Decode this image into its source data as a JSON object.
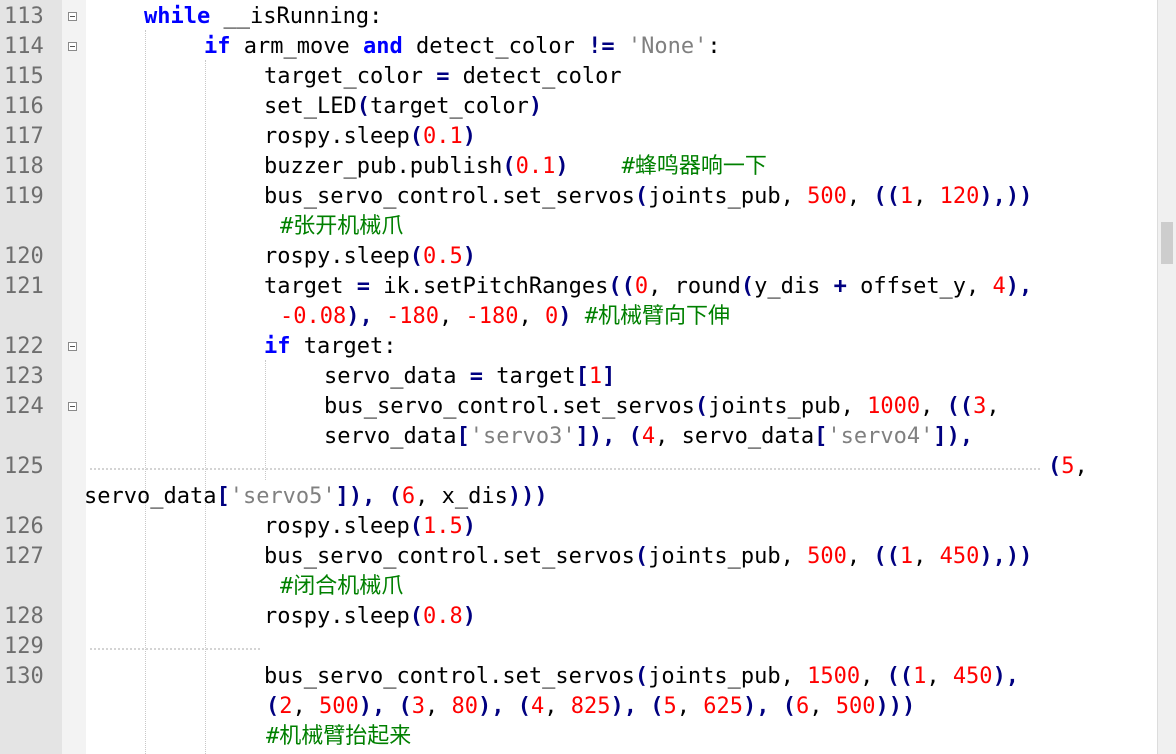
{
  "editor": {
    "lines": {
      "113": {
        "num": "113",
        "kw1": "while",
        "rest": " __isRunning:"
      },
      "114": {
        "num": "114",
        "kw1": "if",
        "a": " arm_move ",
        "kw2": "and",
        "b": " detect_color ",
        "op": "!=",
        "c": " ",
        "str": "'None'",
        "d": ":"
      },
      "115": {
        "num": "115",
        "a": "target_color ",
        "op": "=",
        "b": " detect_color"
      },
      "116": {
        "num": "116",
        "a": "set_LED",
        "p1": "(",
        "b": "target_color",
        "p2": ")"
      },
      "117": {
        "num": "117",
        "a": "rospy.sleep",
        "p1": "(",
        "n1": "0.1",
        "p2": ")"
      },
      "118": {
        "num": "118",
        "a": "buzzer_pub.publish",
        "p1": "(",
        "n1": "0.1",
        "p2": ")",
        "cmt": "#蜂鸣器响一下"
      },
      "119": {
        "num": "119",
        "a": "bus_servo_control.set_servos",
        "p1": "(",
        "b": "joints_pub, ",
        "n1": "500",
        "c": ", ",
        "p2": "((",
        "n2": "1",
        "d": ", ",
        "n3": "120",
        "p3": "),))",
        "cmt": "#张开机械爪"
      },
      "120": {
        "num": "120",
        "a": "rospy.sleep",
        "p1": "(",
        "n1": "0.5",
        "p2": ")"
      },
      "121": {
        "num": "121",
        "a": "target ",
        "op": "=",
        "b": " ik.setPitchRanges",
        "p1": "((",
        "n1": "0",
        "c": ", round",
        "p2": "(",
        "d": "y_dis ",
        "op2": "+",
        "e": " offset_y, ",
        "n2": "4",
        "p3": "),",
        "n3": "-0.08",
        "p4": "),",
        "n4": "-180",
        "f": ", ",
        "n5": "-180",
        "g": ", ",
        "n6": "0",
        "p5": ")",
        "cmt": "#机械臂向下伸"
      },
      "122": {
        "num": "122",
        "kw1": "if",
        "rest": " target:"
      },
      "123": {
        "num": "123",
        "a": "servo_data ",
        "op": "=",
        "b": " target",
        "p1": "[",
        "n1": "1",
        "p2": "]"
      },
      "124": {
        "num": "124",
        "a": "bus_servo_control.set_servos",
        "p1": "(",
        "b": "joints_pub, ",
        "n1": "1000",
        "c": ", ",
        "p2": "((",
        "n2": "3",
        "d": ",",
        "e": "servo_data",
        "p3": "[",
        "s1": "'servo3'",
        "p4": "]),",
        "f": " ",
        "p5": "(",
        "n3": "4",
        "g": ", servo_data",
        "p6": "[",
        "s2": "'servo4'",
        "p7": "]),",
        "p8": "(",
        "n4": "5",
        "h": ","
      },
      "125": {
        "num": "125",
        "a": "servo_data",
        "p1": "[",
        "s1": "'servo5'",
        "p2": "]),",
        "b": " ",
        "p3": "(",
        "n1": "6",
        "c": ", x_dis",
        "p4": ")))"
      },
      "126": {
        "num": "126",
        "a": "rospy.sleep",
        "p1": "(",
        "n1": "1.5",
        "p2": ")"
      },
      "127": {
        "num": "127",
        "a": "bus_servo_control.set_servos",
        "p1": "(",
        "b": "joints_pub, ",
        "n1": "500",
        "c": ", ",
        "p2": "((",
        "n2": "1",
        "d": ", ",
        "n3": "450",
        "p3": "),))",
        "cmt": "#闭合机械爪"
      },
      "128": {
        "num": "128",
        "a": "rospy.sleep",
        "p1": "(",
        "n1": "0.8",
        "p2": ")"
      },
      "129": {
        "num": "129"
      },
      "130": {
        "num": "130",
        "a": "bus_servo_control.set_servos",
        "p1": "(",
        "b": "joints_pub, ",
        "n1": "1500",
        "c": ", ",
        "p2": "((",
        "n2": "1",
        "d": ", ",
        "n3": "450",
        "p3": "),",
        "p4": "(",
        "n4": "2",
        "e": ", ",
        "n5": "500",
        "p5": "),",
        "f": " ",
        "p6": "(",
        "n6": "3",
        "g": ", ",
        "n7": "80",
        "p7": "),",
        "h": " ",
        "p8": "(",
        "n8": "4",
        "i": ", ",
        "n9": "825",
        "p9": "),",
        "j": " ",
        "p10": "(",
        "n10": "5",
        "k": ", ",
        "n11": "625",
        "p11": "),",
        "l": " ",
        "p12": "(",
        "n12": "6",
        "m": ", ",
        "n13": "500",
        "p13": ")))",
        "cmt": "#机械臂抬起来"
      }
    }
  },
  "colors": {
    "keyword": "#0000ff",
    "number": "#ff0000",
    "string": "#808080",
    "comment": "#008000",
    "operator": "#000080",
    "gutter": "#e4e4e4"
  }
}
